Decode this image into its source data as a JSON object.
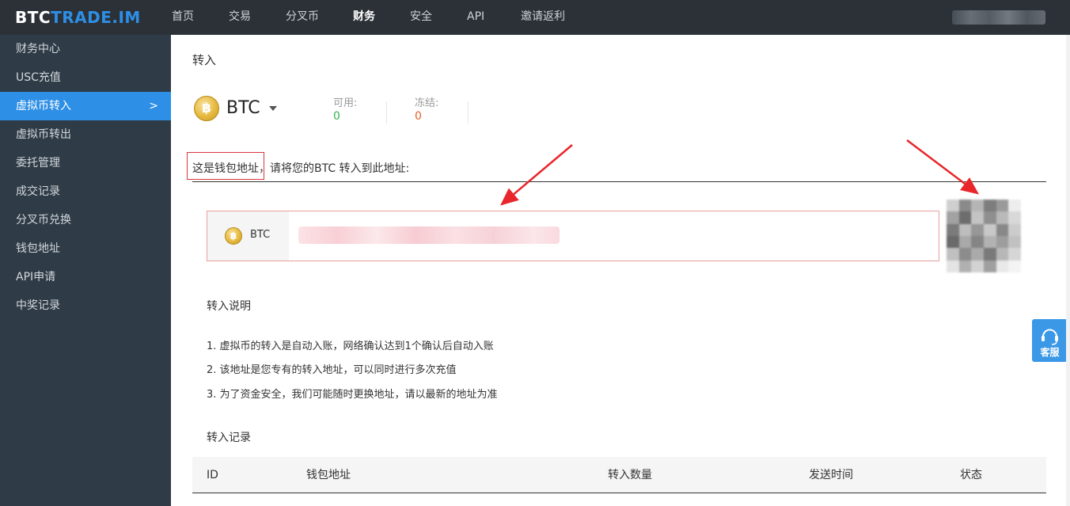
{
  "header": {
    "logo_part1": "BTC",
    "logo_part2": "TRADE.IM",
    "nav": [
      "首页",
      "交易",
      "分叉币",
      "财务",
      "安全",
      "API",
      "邀请返利"
    ],
    "active_nav": "财务"
  },
  "sidebar": {
    "items": [
      "财务中心",
      "USC充值",
      "虚拟币转入",
      "虚拟币转出",
      "委托管理",
      "成交记录",
      "分叉币兑换",
      "钱包地址",
      "API申请",
      "中奖记录"
    ],
    "active": "虚拟币转入",
    "chevron": ">"
  },
  "main": {
    "title": "转入",
    "coin": "BTC",
    "coin_symbol": "฿",
    "available_label": "可用:",
    "available_value": "0",
    "frozen_label": "冻结:",
    "frozen_value": "0",
    "address_label_highlight": "这是钱包地址",
    "address_label_rest": "，请将您的BTC 转入到此地址:",
    "address_coin": "BTC",
    "instructions_title": "转入说明",
    "instructions": [
      "1. 虚拟币的转入是自动入账，网络确认达到1个确认后自动入账",
      "2. 该地址是您专有的转入地址，可以同时进行多次充值",
      "3. 为了资金安全，我们可能随时更换地址，请以最新的地址为准"
    ],
    "records_title": "转入记录",
    "table_headers": [
      "ID",
      "钱包地址",
      "转入数量",
      "发送时间",
      "状态"
    ]
  },
  "customer_service": "客服",
  "colors": {
    "accent": "#2d8fe6",
    "available": "#35b34a",
    "frozen": "#e0632b",
    "highlight_border": "#d9363e",
    "arrow": "#e8262b"
  }
}
